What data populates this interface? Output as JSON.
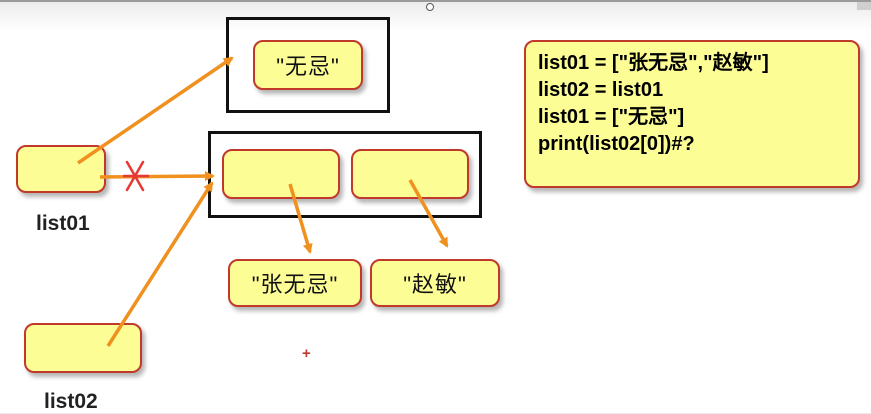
{
  "diagram": {
    "strings": {
      "wuji": "\"无忌\"",
      "zhangwuji": "\"张无忌\"",
      "zhaomin": "\"赵敏\""
    },
    "variables": {
      "list01": "list01",
      "list02": "list02"
    },
    "code": [
      "list01 = [\"张无忌\",\"赵敏\"]",
      "list02 = list01",
      "list01 = [\"无忌\"]",
      "print(list02[0])#?"
    ],
    "annotations": {
      "cursor": "+"
    },
    "colors": {
      "box_fill": "#fdfd96",
      "box_border": "#c0392b",
      "arrow": "#f0901e",
      "cross": "#e53935",
      "frame": "#111111"
    }
  }
}
